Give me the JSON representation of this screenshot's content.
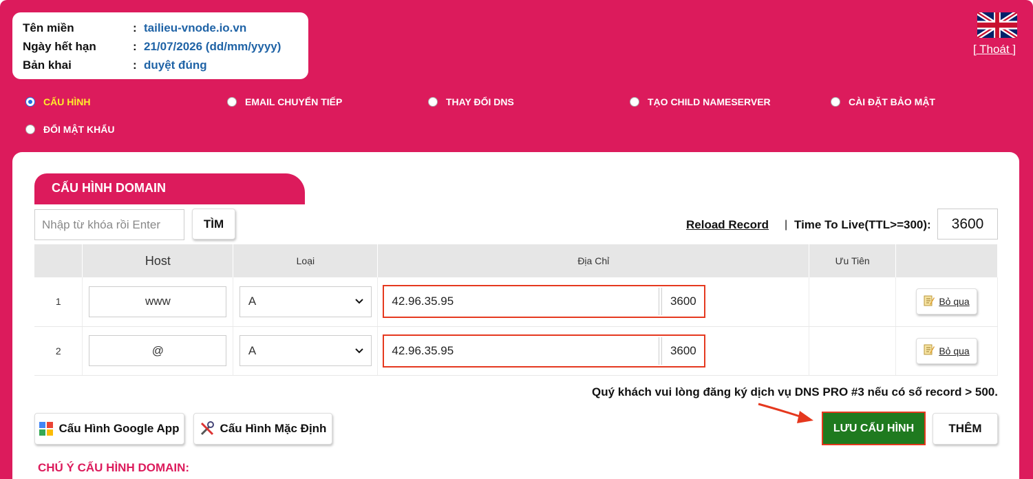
{
  "domain_info": {
    "rows": [
      {
        "label": "Tên miền",
        "value": "tailieu-vnode.io.vn"
      },
      {
        "label": "Ngày hết hạn",
        "value": "21/07/2026 (dd/mm/yyyy)"
      },
      {
        "label": "Bản khai",
        "value": "duyệt đúng"
      }
    ],
    "colon": ":"
  },
  "header": {
    "language_icon": "uk-flag-icon",
    "logout_label": "[ Thoát ]"
  },
  "tabs": [
    {
      "label": "CẤU HÌNH",
      "checked": true
    },
    {
      "label": "EMAIL CHUYỂN TIẾP",
      "checked": false
    },
    {
      "label": "THAY ĐỔI DNS",
      "checked": false
    },
    {
      "label": "TẠO CHILD NAMESERVER",
      "checked": false
    },
    {
      "label": "CÀI ĐẶT BẢO MẬT",
      "checked": false
    },
    {
      "label": "ĐỔI MẬT KHẨU",
      "checked": false
    }
  ],
  "panel": {
    "title": "CẤU HÌNH DOMAIN",
    "search_placeholder": "Nhập từ khóa rồi Enter",
    "search_button": "TÌM",
    "reload_label": "Reload Record",
    "pipe": "|",
    "ttl_label": "Time To Live(TTL>=300):",
    "ttl_value": "3600"
  },
  "table": {
    "headers": {
      "no": "",
      "host": "Host",
      "type": "Loại",
      "address": "Địa Chỉ",
      "priority": "Ưu Tiên",
      "action": ""
    },
    "rows": [
      {
        "no": "1",
        "host": "www",
        "type": "A",
        "address": "42.96.35.95",
        "ttl": "3600",
        "action": "Bỏ qua"
      },
      {
        "no": "2",
        "host": "@",
        "type": "A",
        "address": "42.96.35.95",
        "ttl": "3600",
        "action": "Bỏ qua"
      }
    ]
  },
  "note": "Quý khách vui lòng đăng ký dịch vụ DNS PRO #3 nếu có số record > 500.",
  "buttons": {
    "google": "Cấu Hình Google App",
    "default": "Cấu Hình Mặc Định",
    "save": "LƯU CẤU HÌNH",
    "add": "THÊM"
  },
  "notes_title": "CHÚ Ý CẤU HÌNH DOMAIN:",
  "colors": {
    "brand": "#dc1b5c",
    "link": "#1f63a6",
    "active_tab": "#ffef2a",
    "save": "#1f7a1f",
    "highlight": "#e5381e"
  }
}
